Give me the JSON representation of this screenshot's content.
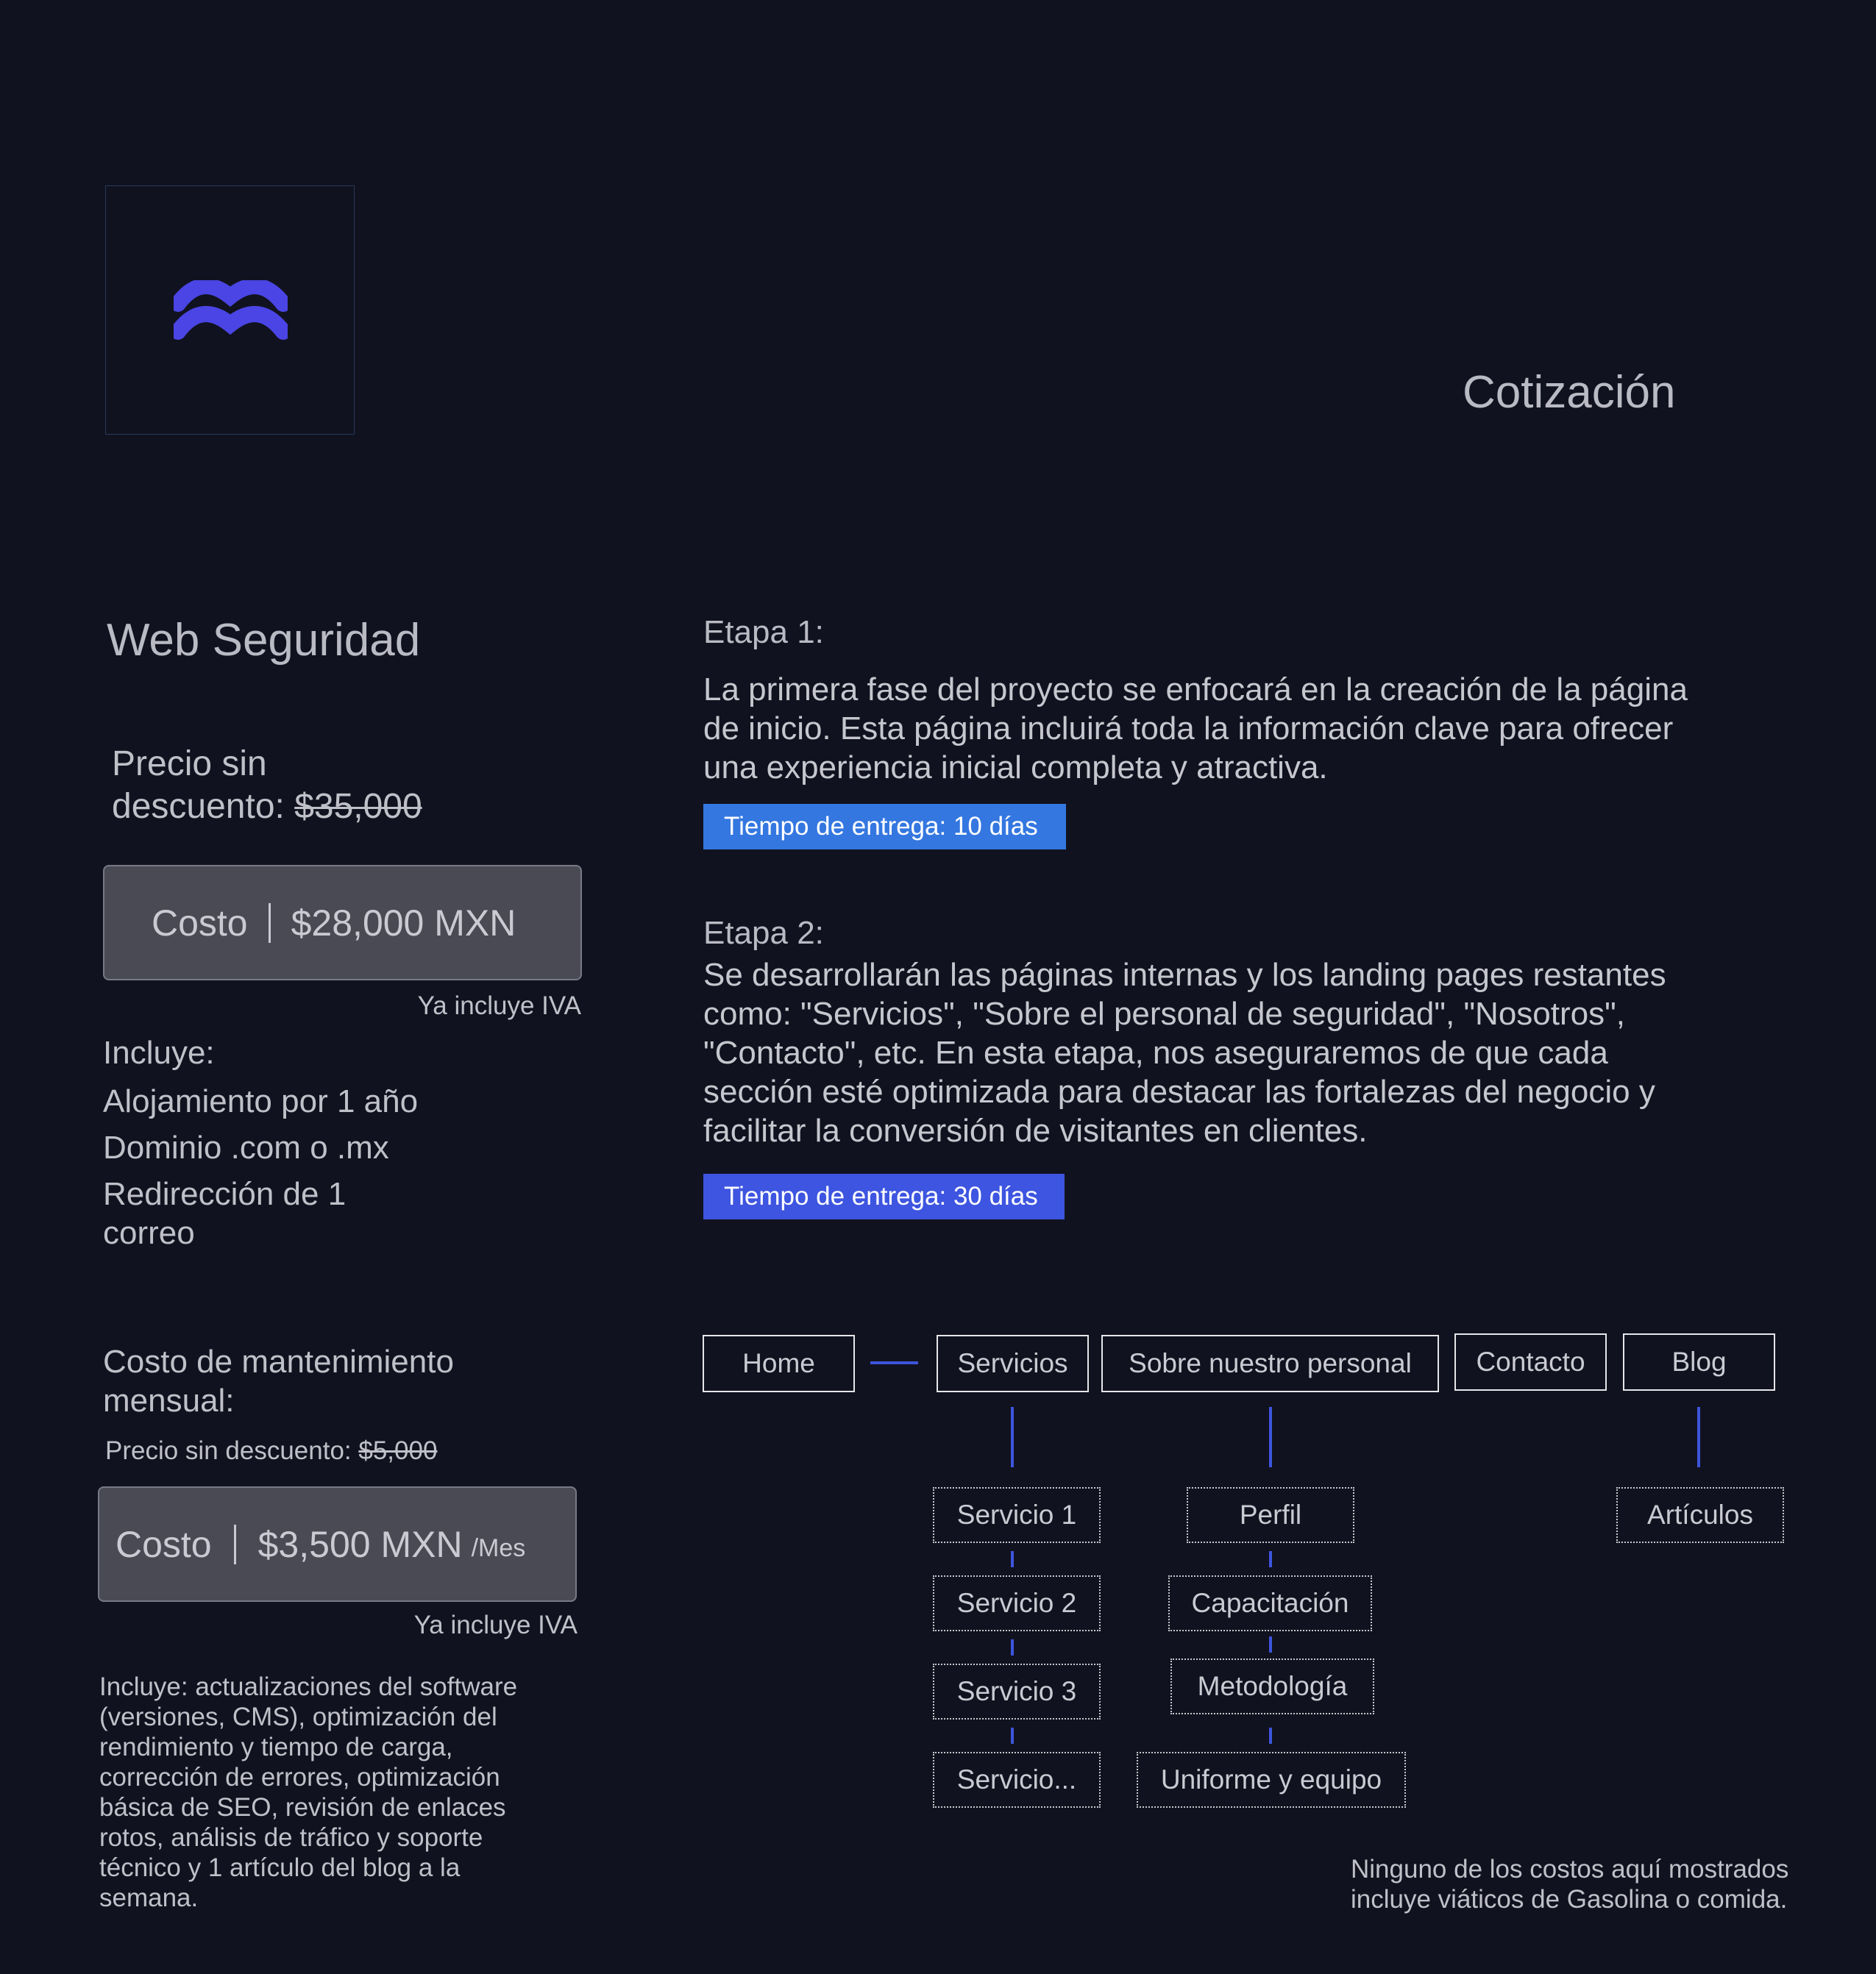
{
  "colors": {
    "background": "#11121f",
    "accent": "#3d55dc",
    "badge1": "#3477e0",
    "badge2": "#3d55e0",
    "cost_box": "#4a4a55"
  },
  "logo": {
    "icon": "waves-icon"
  },
  "header": {
    "title": "Cotización"
  },
  "product": {
    "title": "Web Seguridad",
    "pre_price_label_1": "Precio sin",
    "pre_price_label_2": "descuento: ",
    "pre_price_value": "$35,000",
    "cost_label": "Costo",
    "cost_value": "$28,000 MXN",
    "iva_note": "Ya incluye IVA",
    "includes_title": "Incluye:",
    "includes_items": [
      "Alojamiento por 1 año",
      "Dominio .com o .mx",
      "Redirección de 1",
      "correo"
    ]
  },
  "maintenance": {
    "title_1": "Costo de mantenimiento",
    "title_2": "mensual:",
    "pre_price_label": "Precio sin descuento: ",
    "pre_price_value": "$5,000",
    "cost_label": "Costo",
    "cost_value": "$3,500 MXN",
    "cost_unit": "/Mes",
    "iva_note": "Ya incluye IVA",
    "description_lines": [
      "Incluye: actualizaciones del software",
      "(versiones, CMS), optimización del",
      "rendimiento y tiempo de carga,",
      "corrección de errores, optimización",
      "básica de SEO, revisión de enlaces",
      "rotos, análisis de tráfico y soporte",
      "técnico y 1 artículo del blog a la",
      "semana."
    ]
  },
  "stages": [
    {
      "heading": "Etapa 1:",
      "body_lines": [
        "La primera fase del proyecto se enfocará en la creación de la página",
        "de inicio. Esta página incluirá toda la información clave para ofrecer",
        "una experiencia inicial completa y atractiva."
      ],
      "delivery": "Tiempo de entrega: 10 días"
    },
    {
      "heading": "Etapa 2:",
      "body_lines": [
        "Se desarrollarán las páginas internas y los landing pages restantes",
        "como: \"Servicios\", \"Sobre el personal de seguridad\", \"Nosotros\",",
        "\"Contacto\", etc. En esta etapa, nos aseguraremos de que cada",
        "sección esté optimizada para destacar las fortalezas del negocio y",
        "facilitar la conversión de visitantes en clientes."
      ],
      "delivery": "Tiempo de entrega: 30 días"
    }
  ],
  "sitemap": {
    "pages": [
      "Home",
      "Servicios",
      "Sobre nuestro personal",
      "Contacto",
      "Blog"
    ],
    "servicios_children": [
      "Servicio 1",
      "Servicio 2",
      "Servicio 3",
      "Servicio..."
    ],
    "personal_children": [
      "Perfil",
      "Capacitación",
      "Metodología",
      "Uniforme y equipo"
    ],
    "blog_children": [
      "Artículos"
    ]
  },
  "footer_note_lines": [
    "Ninguno de los costos aquí mostrados",
    "incluye viáticos de Gasolina o comida."
  ]
}
